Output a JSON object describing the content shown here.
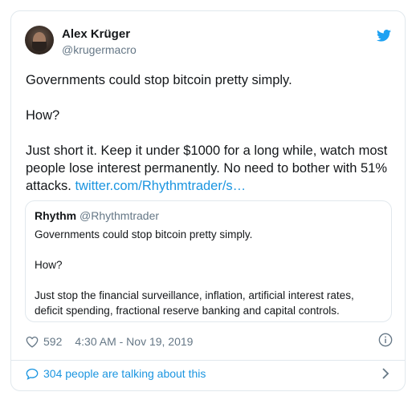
{
  "tweet": {
    "author": {
      "name": "Alex Krüger",
      "handle": "@krugermacro"
    },
    "text": {
      "line1": "Governments could stop bitcoin pretty simply.",
      "line2": "How?",
      "line3": "Just short it. Keep it under $1000 for a long while, watch most people lose interest permanently. No need to bother with 51% attacks.",
      "link": "twitter.com/Rhythmtrader/s…"
    },
    "quote": {
      "name": "Rhythm",
      "handle": "@Rhythmtrader",
      "line1": "Governments could stop bitcoin pretty simply.",
      "line2": "How?",
      "line3": "Just stop the financial surveillance, inflation, artificial interest rates, deficit spending, fractional reserve banking and capital controls."
    },
    "meta": {
      "likes": "592",
      "timestamp": "4:30 AM - Nov 19, 2019"
    },
    "conversation": "304 people are talking about this"
  },
  "colors": {
    "link": "#1b95e0",
    "muted": "#657786",
    "text": "#14171a",
    "border": "#e1e8ed"
  },
  "icons": [
    "avatar",
    "twitter-bird-icon",
    "heart-icon",
    "info-icon",
    "comment-bubble-icon",
    "chevron-right-icon"
  ]
}
